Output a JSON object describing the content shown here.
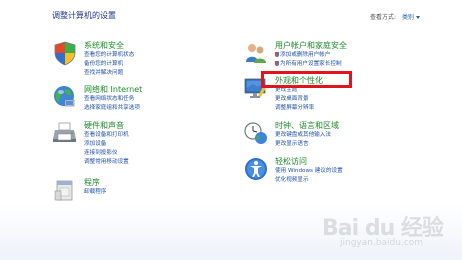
{
  "header": {
    "title": "调整计算机的设置",
    "view_by_label": "查看方式:",
    "view_by_value": "类别"
  },
  "categories": {
    "system": {
      "heading": "系统和安全",
      "links": [
        "查看您的计算机状态",
        "备份您的计算机",
        "查找并解决问题"
      ]
    },
    "network": {
      "heading": "网络和 Internet",
      "links": [
        "查看网络状态和任务",
        "选择家庭组和共享选项"
      ]
    },
    "hardware": {
      "heading": "硬件和声音",
      "links": [
        "查看设备和打印机",
        "添加设备",
        "连接到投影仪",
        "调整常用移动设置"
      ]
    },
    "programs": {
      "heading": "程序",
      "links": [
        "卸载程序"
      ]
    },
    "users": {
      "heading": "用户帐户和家庭安全",
      "links": [
        "添加或删除用户帐户",
        "为所有用户设置家长控制"
      ]
    },
    "appearance": {
      "heading": "外观和个性化",
      "links": [
        "更改主题",
        "更改桌面背景",
        "调整屏幕分辨率"
      ]
    },
    "clock": {
      "heading": "时钟、语言和区域",
      "links": [
        "更改键盘或其他输入法",
        "更改显示语言"
      ]
    },
    "ease": {
      "heading": "轻松访问",
      "links": [
        "使用 Windows 建议的设置",
        "优化视频显示"
      ]
    }
  },
  "watermark": {
    "text": "Bai du 经验",
    "sub": "jingyan.baidu.com"
  },
  "colors": {
    "heading_green": "#1f8a28",
    "link_blue": "#1e4fa6",
    "title_navy": "#1e3287",
    "highlight_red": "#e0141d"
  }
}
